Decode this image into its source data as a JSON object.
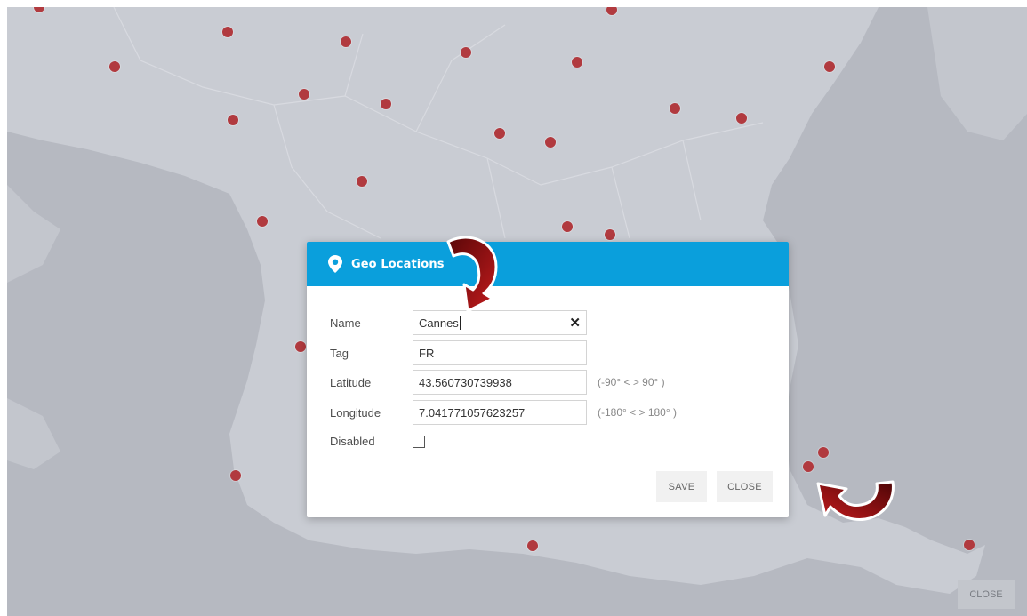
{
  "map": {
    "land_color": "#c9ccd3",
    "sea_color": "#b6b9c1",
    "marker_color": "#b13a3f",
    "markers": [
      {
        "name": "marker-1"
      },
      {
        "name": "marker-2"
      },
      {
        "name": "marker-3"
      },
      {
        "name": "marker-4"
      },
      {
        "name": "marker-5"
      },
      {
        "name": "marker-6"
      },
      {
        "name": "marker-7"
      },
      {
        "name": "marker-8"
      },
      {
        "name": "marker-9"
      },
      {
        "name": "marker-10"
      },
      {
        "name": "marker-11"
      },
      {
        "name": "marker-12"
      },
      {
        "name": "marker-13"
      },
      {
        "name": "marker-14"
      },
      {
        "name": "marker-15"
      },
      {
        "name": "marker-16"
      },
      {
        "name": "marker-17"
      },
      {
        "name": "marker-18"
      },
      {
        "name": "marker-19"
      },
      {
        "name": "marker-20"
      },
      {
        "name": "marker-21"
      },
      {
        "name": "marker-22"
      },
      {
        "name": "marker-23"
      },
      {
        "name": "marker-24"
      },
      {
        "name": "marker-25"
      }
    ]
  },
  "dialog": {
    "title": "Geo Locations",
    "icon": "map-pin-icon",
    "header_color": "#0a9fdc",
    "fields": {
      "name": {
        "label": "Name",
        "value": "Cannes",
        "clear_icon": "✕"
      },
      "tag": {
        "label": "Tag",
        "value": "FR"
      },
      "latitude": {
        "label": "Latitude",
        "value": "43.560730739938",
        "hint": "(-90° < > 90° )"
      },
      "longitude": {
        "label": "Longitude",
        "value": "7.041771057623257",
        "hint": "(-180° < > 180° )"
      },
      "disabled": {
        "label": "Disabled",
        "checked": false
      }
    },
    "buttons": {
      "save": "SAVE",
      "close": "CLOSE"
    }
  },
  "page": {
    "close_label": "CLOSE"
  },
  "annotations": {
    "arrow_color": "#9e1214"
  }
}
